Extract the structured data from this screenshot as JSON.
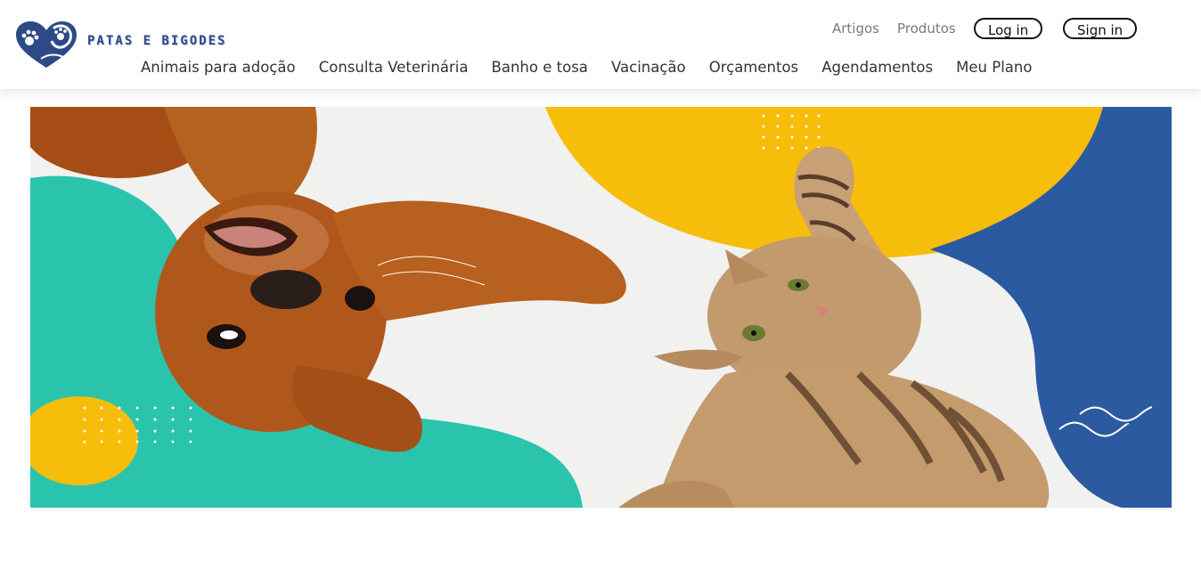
{
  "brand": {
    "name": "PATAS E BIGODES",
    "logo_icon": "heart-paw-icon",
    "color": "#2d4a86"
  },
  "top_links": [
    {
      "label": "Artigos"
    },
    {
      "label": "Produtos"
    }
  ],
  "auth": {
    "login_label": "Log in",
    "signin_label": "Sign in"
  },
  "nav": [
    {
      "label": "Animais para adoção"
    },
    {
      "label": "Consulta Veterinária"
    },
    {
      "label": "Banho e tosa"
    },
    {
      "label": "Vacinação"
    },
    {
      "label": "Orçamentos"
    },
    {
      "label": "Agendamentos"
    },
    {
      "label": "Meu Plano"
    }
  ],
  "hero": {
    "image": "hero-banner-dog-and-cat",
    "colors": {
      "teal": "#2ac4ad",
      "yellow": "#f7bd0b",
      "blue": "#2c5aa0",
      "background": "#f1f1f0",
      "dog": "#b0581c",
      "cat": "#c29a6e"
    }
  }
}
